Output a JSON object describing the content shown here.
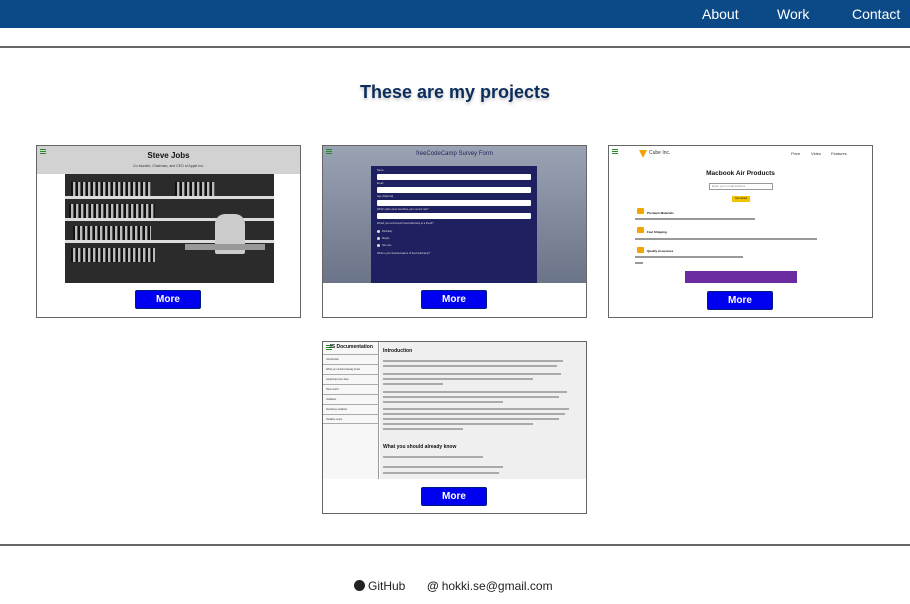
{
  "nav": {
    "about": "About",
    "work": "Work",
    "contact": "Contact"
  },
  "colors": {
    "navbar": "#0b4a86",
    "heading": "#0b2d5c",
    "button": "#0000f0"
  },
  "heading": "These are my projects",
  "cards": [
    {
      "title": "Steve Jobs",
      "subtitle": "Co-founder, Chairman, and CEO of Apple Inc.",
      "button": "More"
    },
    {
      "title": "freeCodeCamp Survey Form",
      "button": "More",
      "labels": [
        "Name",
        "Email",
        "Age (Optional)",
        "Which option best describes your current role?",
        "Would you recommend freeCodeCamp to a friend?",
        "Definitely",
        "Maybe",
        "Not sure",
        "What is your favorite feature of freeCodeCamp?"
      ]
    },
    {
      "brand": "Cube Inc.",
      "nav": [
        "Price",
        "Video",
        "Features"
      ],
      "title": "Macbook Air Products",
      "email_placeholder": "Enter your email address",
      "cta": "Get started",
      "features": [
        "Premium Materials",
        "Fast Shipping",
        "Quality Assurance"
      ],
      "button": "More"
    },
    {
      "sidebar_title": "JS Documentation",
      "nav": [
        "Introduction",
        "What you should already know",
        "JavaScript and Java",
        "Hello world",
        "Variables",
        "Declaring variables",
        "Variable scope"
      ],
      "headings": [
        "Introduction",
        "What you should already know"
      ],
      "button": "More"
    }
  ],
  "footer": {
    "github": "GitHub",
    "email": "hokki.se@gmail.com"
  }
}
